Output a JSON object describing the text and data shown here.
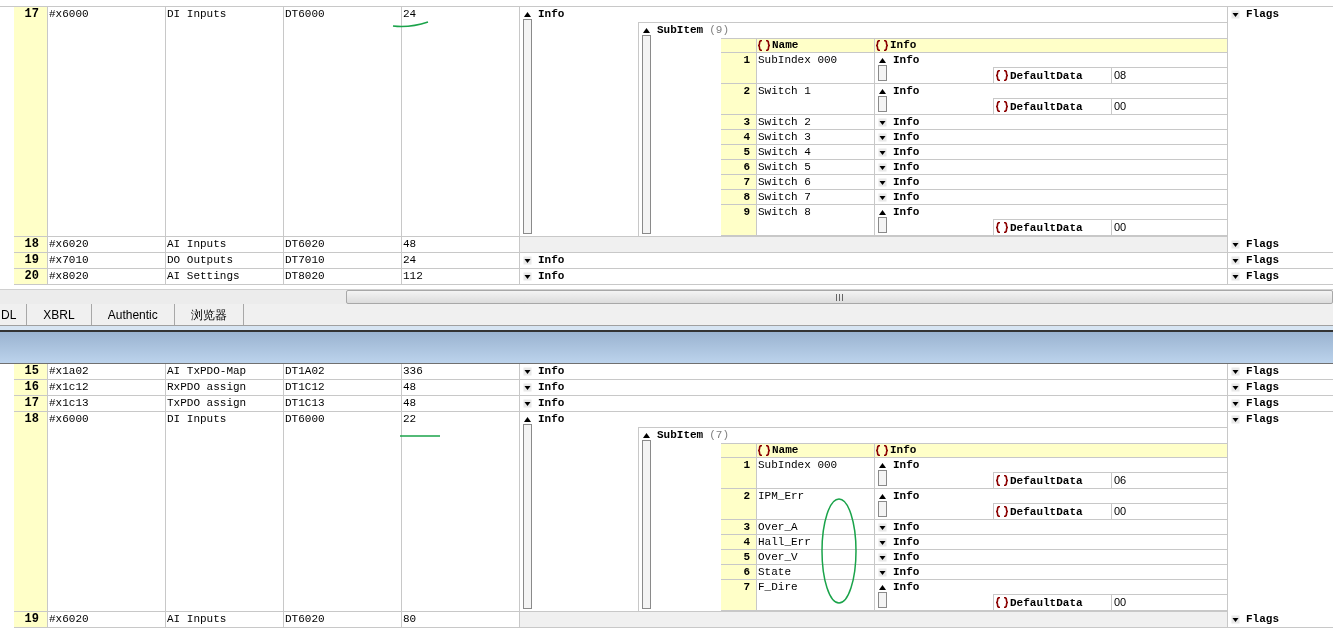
{
  "top_pane": {
    "rows": [
      {
        "num": "17",
        "index": "#x6000",
        "name": "DI Inputs",
        "type": "DT6000",
        "size": "24",
        "info": {
          "label": "Info",
          "expanded": true,
          "subitems": {
            "title": "SubItem",
            "count": "(9)",
            "columns": [
              "Name",
              "Info"
            ],
            "items": [
              {
                "num": "1",
                "name": "SubIndex 000",
                "info": "Info",
                "expanded": true,
                "default_label": "DefaultData",
                "default_value": "08"
              },
              {
                "num": "2",
                "name": "Switch 1",
                "info": "Info",
                "expanded": true,
                "default_label": "DefaultData",
                "default_value": "00"
              },
              {
                "num": "3",
                "name": "Switch 2",
                "info": "Info",
                "expanded": false
              },
              {
                "num": "4",
                "name": "Switch 3",
                "info": "Info",
                "expanded": false
              },
              {
                "num": "5",
                "name": "Switch 4",
                "info": "Info",
                "expanded": false
              },
              {
                "num": "6",
                "name": "Switch 5",
                "info": "Info",
                "expanded": false
              },
              {
                "num": "7",
                "name": "Switch 6",
                "info": "Info",
                "expanded": false
              },
              {
                "num": "8",
                "name": "Switch 7",
                "info": "Info",
                "expanded": false
              },
              {
                "num": "9",
                "name": "Switch 8",
                "info": "Info",
                "expanded": true,
                "default_label": "DefaultData",
                "default_value": "00"
              }
            ]
          }
        },
        "flags": {
          "label": "Flags",
          "expanded": false
        }
      },
      {
        "num": "18",
        "index": "#x6020",
        "name": "AI Inputs",
        "type": "DT6020",
        "size": "48",
        "flags": {
          "label": "Flags",
          "expanded": false
        }
      },
      {
        "num": "19",
        "index": "#x7010",
        "name": "DO Outputs",
        "type": "DT7010",
        "size": "24",
        "info": {
          "label": "Info",
          "expanded": false
        },
        "flags": {
          "label": "Flags",
          "expanded": false
        }
      },
      {
        "num": "20",
        "index": "#x8020",
        "name": "AI Settings",
        "type": "DT8020",
        "size": "112",
        "info": {
          "label": "Info",
          "expanded": false
        },
        "flags": {
          "label": "Flags",
          "expanded": false
        }
      }
    ]
  },
  "tabs": [
    {
      "label": "DL",
      "selected": false
    },
    {
      "label": "XBRL",
      "selected": false
    },
    {
      "label": "Authentic",
      "selected": false
    },
    {
      "label": "浏览器",
      "selected": false
    }
  ],
  "bottom_pane": {
    "rows": [
      {
        "num": "15",
        "index": "#x1a02",
        "name": "AI TxPDO-Map",
        "type": "DT1A02",
        "size": "336",
        "info": {
          "label": "Info",
          "expanded": false
        },
        "flags": {
          "label": "Flags",
          "expanded": false
        }
      },
      {
        "num": "16",
        "index": "#x1c12",
        "name": "RxPDO assign",
        "type": "DT1C12",
        "size": "48",
        "info": {
          "label": "Info",
          "expanded": false
        },
        "flags": {
          "label": "Flags",
          "expanded": false
        }
      },
      {
        "num": "17",
        "index": "#x1c13",
        "name": "TxPDO assign",
        "type": "DT1C13",
        "size": "48",
        "info": {
          "label": "Info",
          "expanded": false
        },
        "flags": {
          "label": "Flags",
          "expanded": false
        }
      },
      {
        "num": "18",
        "index": "#x6000",
        "name": "DI Inputs",
        "type": "DT6000",
        "size": "22",
        "info": {
          "label": "Info",
          "expanded": true,
          "subitems": {
            "title": "SubItem",
            "count": "(7)",
            "columns": [
              "Name",
              "Info"
            ],
            "items": [
              {
                "num": "1",
                "name": "SubIndex 000",
                "info": "Info",
                "expanded": true,
                "default_label": "DefaultData",
                "default_value": "06"
              },
              {
                "num": "2",
                "name": "IPM_Err",
                "info": "Info",
                "expanded": true,
                "default_label": "DefaultData",
                "default_value": "00"
              },
              {
                "num": "3",
                "name": "Over_A",
                "info": "Info",
                "expanded": false
              },
              {
                "num": "4",
                "name": "Hall_Err",
                "info": "Info",
                "expanded": false
              },
              {
                "num": "5",
                "name": "Over_V",
                "info": "Info",
                "expanded": false
              },
              {
                "num": "6",
                "name": "State",
                "info": "Info",
                "expanded": false
              },
              {
                "num": "7",
                "name": "F_Dire",
                "info": "Info",
                "expanded": true,
                "default_label": "DefaultData",
                "default_value": "00"
              }
            ]
          }
        },
        "flags": {
          "label": "Flags",
          "expanded": false
        }
      },
      {
        "num": "19",
        "index": "#x6020",
        "name": "AI Inputs",
        "type": "DT6020",
        "size": "80",
        "flags": {
          "label": "Flags",
          "expanded": false
        }
      }
    ]
  }
}
